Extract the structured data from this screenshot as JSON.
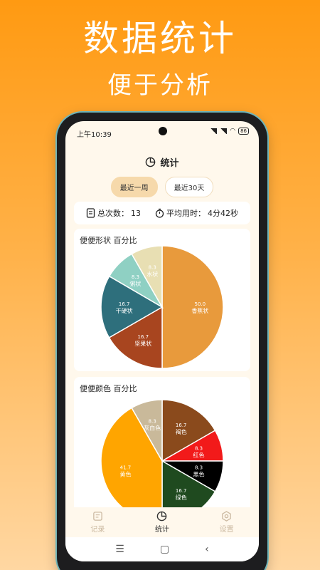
{
  "promo": {
    "headline": "数据统计",
    "subline": "便于分析"
  },
  "status_bar": {
    "time": "上午10:39",
    "battery": "86"
  },
  "header": {
    "title": "统计",
    "icon": "pie-chart-icon"
  },
  "tabs": [
    {
      "label": "最近一周",
      "active": true
    },
    {
      "label": "最近30天",
      "active": false
    }
  ],
  "summary": {
    "count_label": "总次数：",
    "count_value": "13",
    "avg_label": "平均用时：",
    "avg_value": "4分42秒"
  },
  "chart_data": [
    {
      "type": "pie",
      "title": "便便形状 百分比",
      "series": [
        {
          "name": "香蕉状",
          "value": 50.0,
          "color": "#e89a3c",
          "label_color": "#ffffff"
        },
        {
          "name": "坚果状",
          "value": 16.7,
          "color": "#a8451f",
          "label_color": "#ffffff"
        },
        {
          "name": "干硬状",
          "value": 16.7,
          "color": "#2e6f7c",
          "label_color": "#ffffff"
        },
        {
          "name": "粥状",
          "value": 8.3,
          "color": "#8fd0c3",
          "label_color": "#ffffff"
        },
        {
          "name": "水状",
          "value": 8.3,
          "color": "#e8dfb3",
          "label_color": "#ffffff"
        }
      ]
    },
    {
      "type": "pie",
      "title": "便便颜色 百分比",
      "series": [
        {
          "name": "褐色",
          "value": 16.7,
          "color": "#8a4a1c",
          "label_color": "#ffffff"
        },
        {
          "name": "红色",
          "value": 8.3,
          "color": "#f21a1a",
          "label_color": "#ffffff"
        },
        {
          "name": "黑色",
          "value": 8.3,
          "color": "#000000",
          "label_color": "#ffffff"
        },
        {
          "name": "绿色",
          "value": 16.7,
          "color": "#1f4a1f",
          "label_color": "#ffffff"
        },
        {
          "name": "黄色",
          "value": 41.7,
          "color": "#ffa500",
          "label_color": "#ffffff"
        },
        {
          "name": "灰白色",
          "value": 8.3,
          "color": "#c9b99a",
          "label_color": "#ffffff"
        }
      ]
    }
  ],
  "bottom_nav": [
    {
      "label": "记录",
      "icon": "record-icon",
      "active": false
    },
    {
      "label": "统计",
      "icon": "pie-chart-icon",
      "active": true
    },
    {
      "label": "设置",
      "icon": "gear-icon",
      "active": false
    }
  ],
  "system_nav": {
    "menu": "☰",
    "home": "▢",
    "back": "‹"
  }
}
